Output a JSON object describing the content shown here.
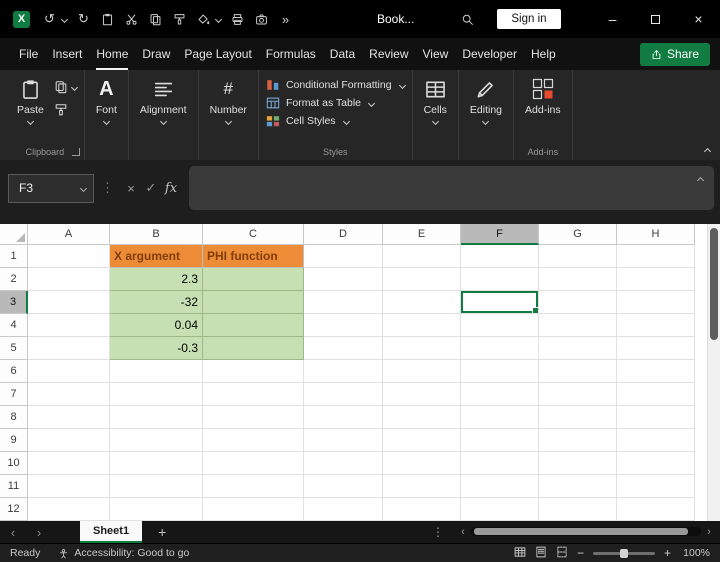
{
  "colors": {
    "accent_green": "#107C41",
    "orange_fill": "#ED8C37",
    "orange_text": "#843C0C",
    "green_fill": "#C6E0B4"
  },
  "glyphs": {
    "logo": "X",
    "undo": "↺",
    "redo": "↻",
    "more": "»",
    "dots": "⋮",
    "cancel": "×",
    "check": "✓",
    "prev": "‹",
    "next": "›",
    "minus": "−",
    "plus": "+",
    "minimize": "–",
    "close": "×",
    "menu_dots": "⋮",
    "font_icon": "A",
    "number_icon": "#"
  },
  "titlebar": {
    "workbook_title": "Book...",
    "sign_in": "Sign in"
  },
  "ribbon_tabs": [
    {
      "label": "File"
    },
    {
      "label": "Insert"
    },
    {
      "label": "Home",
      "active": true
    },
    {
      "label": "Draw"
    },
    {
      "label": "Page Layout"
    },
    {
      "label": "Formulas"
    },
    {
      "label": "Data"
    },
    {
      "label": "Review"
    },
    {
      "label": "View"
    },
    {
      "label": "Developer"
    },
    {
      "label": "Help"
    }
  ],
  "share": {
    "label": "Share"
  },
  "ribbon": {
    "paste": "Paste",
    "font": "Font",
    "alignment": "Alignment",
    "number": "Number",
    "conditional_formatting": "Conditional Formatting",
    "format_as_table": "Format as Table",
    "cell_styles": "Cell Styles",
    "cells": "Cells",
    "editing": "Editing",
    "addins": "Add-ins",
    "groups": {
      "clipboard": "Clipboard",
      "styles": "Styles",
      "addins": "Add-ins"
    }
  },
  "formula_bar": {
    "name_box": "F3",
    "fx_label": "fx",
    "formula": ""
  },
  "grid": {
    "columns": [
      "A",
      "B",
      "C",
      "D",
      "E",
      "F",
      "G",
      "H"
    ],
    "rows": [
      "1",
      "2",
      "3",
      "4",
      "5",
      "6",
      "7",
      "8",
      "9",
      "10",
      "11",
      "12"
    ],
    "selected_cell": "F3",
    "cells": {
      "B1": {
        "text": "X argument",
        "style": "orange"
      },
      "C1": {
        "text": "PHI function",
        "style": "orange"
      },
      "B2": {
        "text": "2.3",
        "style": "green num"
      },
      "B3": {
        "text": "-32",
        "style": "green num"
      },
      "B4": {
        "text": "0.04",
        "style": "green num"
      },
      "B5": {
        "text": "-0.3",
        "style": "green num"
      },
      "C2": {
        "style": "green"
      },
      "C3": {
        "style": "green"
      },
      "C4": {
        "style": "green"
      },
      "C5": {
        "style": "green"
      }
    }
  },
  "sheet_bar": {
    "tabs": [
      {
        "label": "Sheet1",
        "active": true
      }
    ],
    "new_sheet": "+"
  },
  "status_bar": {
    "ready": "Ready",
    "accessibility": "Accessibility: Good to go",
    "zoom": "100%"
  }
}
